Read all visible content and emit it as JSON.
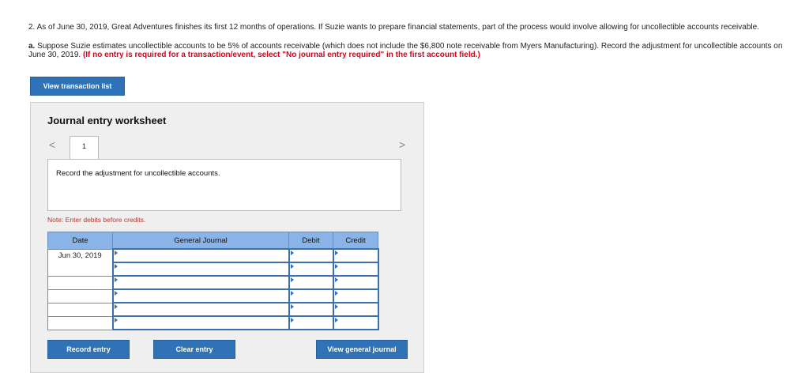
{
  "question": {
    "intro": "2. As of June 30, 2019, Great Adventures finishes its first 12 months of operations. If Suzie wants to prepare financial statements, part of the process would involve allowing for uncollectible accounts receivable.",
    "part_label": "a.",
    "part_text": "Suppose Suzie estimates uncollectible accounts to be 5% of accounts receivable (which does not include the $6,800 note receivable from Myers Manufacturing). Record the adjustment for uncollectible accounts on June 30, 2019.",
    "instruction": "(If no entry is required for a transaction/event, select \"No journal entry required\" in the first account field.)"
  },
  "buttons": {
    "view_transactions": "View transaction list",
    "record_entry": "Record entry",
    "clear_entry": "Clear entry",
    "view_journal": "View general journal"
  },
  "worksheet": {
    "title": "Journal entry worksheet",
    "nav_prev": "<",
    "nav_next": ">",
    "tab_number": "1",
    "description": "Record the adjustment for uncollectible accounts.",
    "note": "Note: Enter debits before credits."
  },
  "table": {
    "headers": [
      "Date",
      "General Journal",
      "Debit",
      "Credit"
    ],
    "rows": [
      {
        "date": "Jun 30, 2019"
      },
      {
        "date": ""
      },
      {
        "date": ""
      },
      {
        "date": ""
      },
      {
        "date": ""
      },
      {
        "date": ""
      }
    ]
  }
}
